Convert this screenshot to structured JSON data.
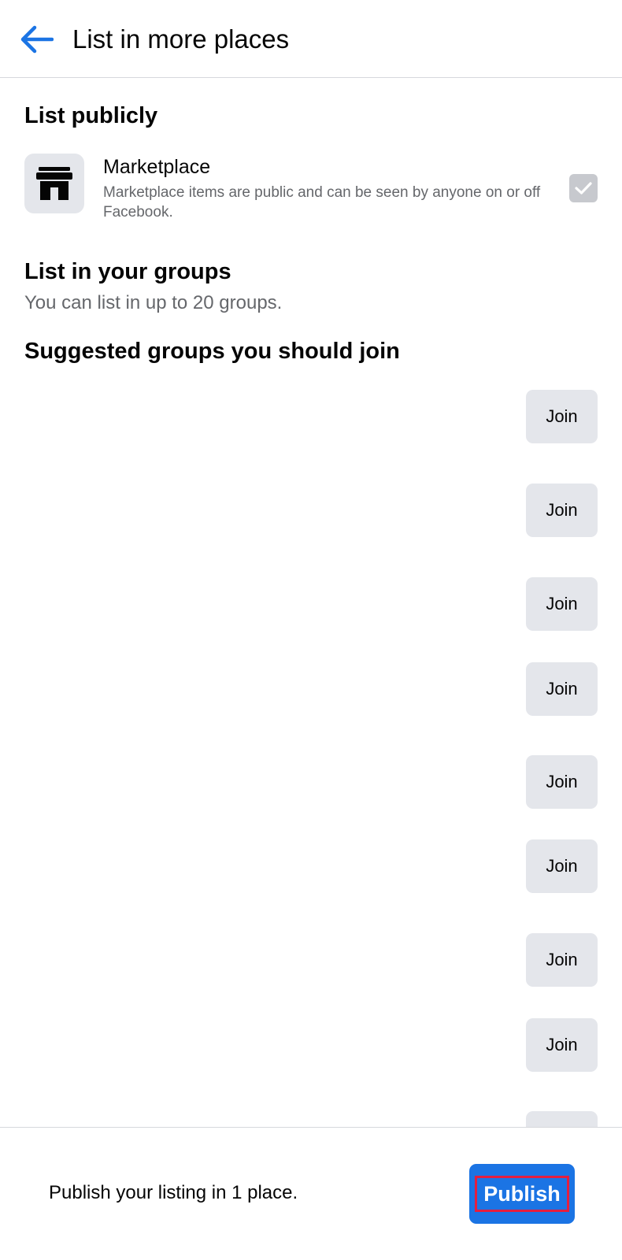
{
  "header": {
    "title": "List in more places",
    "back_icon": "arrow-left-icon",
    "accent_color": "#1b74e4"
  },
  "list_publicly": {
    "title": "List publicly",
    "marketplace": {
      "icon": "storefront-icon",
      "title": "Marketplace",
      "description": "Marketplace items are public and can be seen by anyone on or off Facebook.",
      "checked": true
    }
  },
  "groups": {
    "title": "List in your groups",
    "subtitle": "You can list in up to 20 groups."
  },
  "suggested": {
    "title": "Suggested groups you should join",
    "join_buttons": [
      "Join",
      "Join",
      "Join",
      "Join",
      "Join",
      "Join",
      "Join",
      "Join"
    ]
  },
  "footer": {
    "message": "Publish your listing in 1 place.",
    "publish_label": "Publish",
    "publish_color": "#1b74e4"
  }
}
